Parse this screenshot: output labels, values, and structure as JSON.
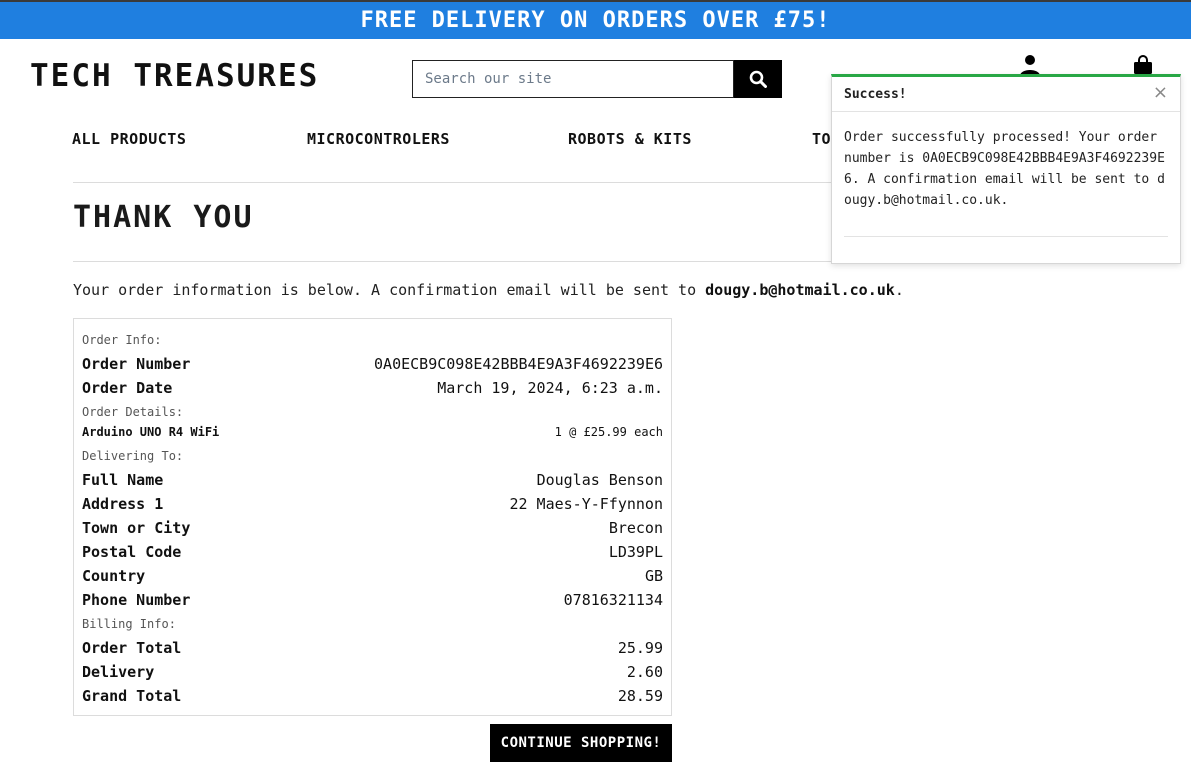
{
  "banner": {
    "text": "FREE DELIVERY ON ORDERS OVER £75!"
  },
  "header": {
    "logo": "TECH TREASURES",
    "search_placeholder": "Search our site",
    "icons": {
      "search": "search-icon",
      "account": "user-icon",
      "bag": "shopping-bag-icon"
    }
  },
  "nav": {
    "items": [
      {
        "label": "ALL PRODUCTS"
      },
      {
        "label": "MICROCONTROLERS"
      },
      {
        "label": "ROBOTS & KITS"
      },
      {
        "label": "TO"
      }
    ]
  },
  "page": {
    "title": "THANK YOU",
    "intro_prefix": "Your order information is below. A confirmation email will be sent to ",
    "email": "dougy.b@hotmail.co.uk",
    "intro_suffix": "."
  },
  "order": {
    "order_info_label": "Order Info:",
    "order_info": [
      {
        "key": "Order Number",
        "value": "0A0ECB9C098E42BBB4E9A3F4692239E6"
      },
      {
        "key": "Order Date",
        "value": "March 19, 2024, 6:23 a.m."
      }
    ],
    "details_label": "Order Details:",
    "items": [
      {
        "name": "Arduino UNO R4 WiFi",
        "qty_price": "1 @ £25.99 each"
      }
    ],
    "delivering_label": "Delivering To:",
    "delivery": [
      {
        "key": "Full Name",
        "value": "Douglas Benson"
      },
      {
        "key": "Address 1",
        "value": "22 Maes-Y-Ffynnon"
      },
      {
        "key": "Town or City",
        "value": "Brecon"
      },
      {
        "key": "Postal Code",
        "value": "LD39PL"
      },
      {
        "key": "Country",
        "value": "GB"
      },
      {
        "key": "Phone Number",
        "value": "07816321134"
      }
    ],
    "billing_label": "Billing Info:",
    "billing": [
      {
        "key": "Order Total",
        "value": "25.99"
      },
      {
        "key": "Delivery",
        "value": "2.60"
      },
      {
        "key": "Grand Total",
        "value": "28.59"
      }
    ]
  },
  "continue_button": "CONTINUE SHOPPING!",
  "toast": {
    "title": "Success!",
    "close": "×",
    "message": "Order successfully processed! Your order number is 0A0ECB9C098E42BBB4E9A3F4692239E6. A confirmation email will be sent to dougy.b@hotmail.co.uk."
  },
  "colors": {
    "banner": "#1f7fe0",
    "success_accent": "#28a745"
  }
}
